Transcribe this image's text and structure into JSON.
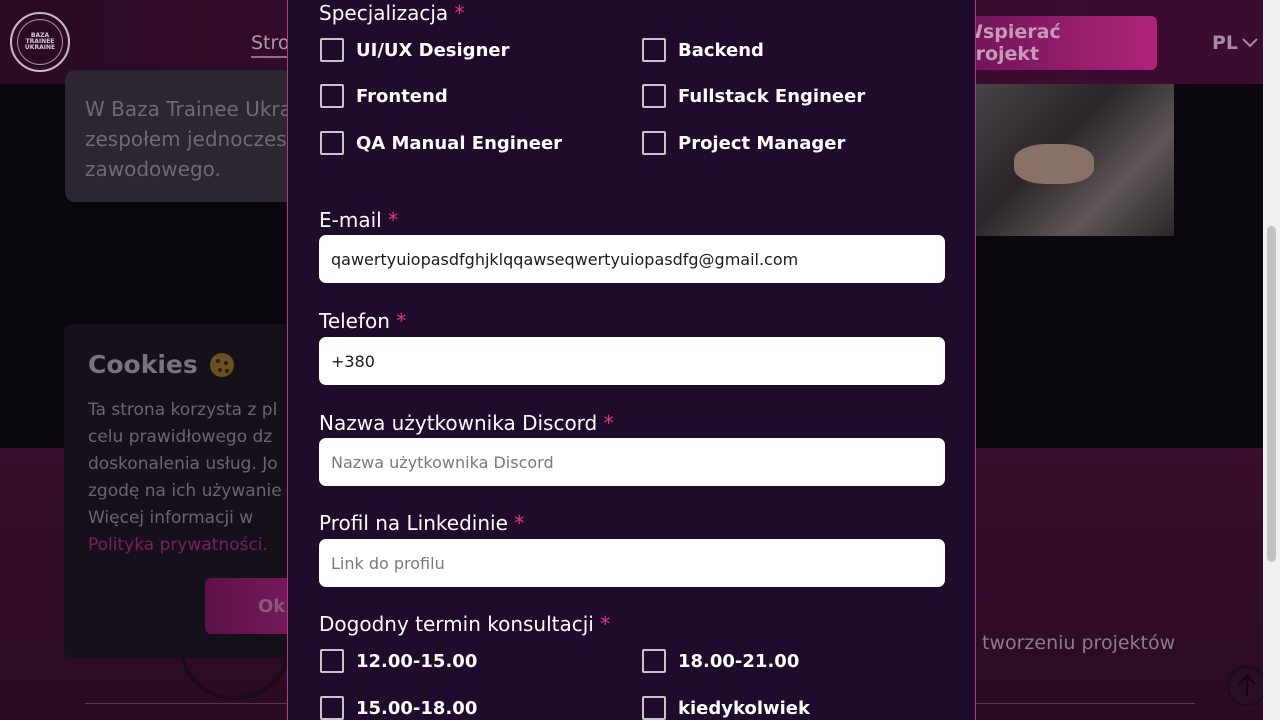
{
  "header": {
    "logo_text": "BAZA\nTRAINEE\nUKRAINE",
    "nav_link": "Stro",
    "support_button": "Wspierać projekt",
    "language": "PL"
  },
  "background": {
    "intro_text": "W Baza Trainee Ukra\nzespołem jednoczes\nzawodowego.",
    "right_text": "tworzeniu projektów"
  },
  "cookies": {
    "title": "Cookies",
    "text": "Ta strona korzysta z pl\ncelu prawidłowego dz\ndoskonalenia usług. Jo\nzgodę na ich używanie\nWięcej informacji w",
    "link": "Polityka prywatności.",
    "ok_button": "Ok"
  },
  "form": {
    "specialization": {
      "label": "Specjalizacja",
      "required": "*",
      "options": [
        "UI/UX Designer",
        "Backend",
        "Frontend",
        "Fullstack Engineer",
        "QA Manual Engineer",
        "Project Manager"
      ]
    },
    "email": {
      "label": "E-mail",
      "required": "*",
      "value": "qawertyuiopasdfghjklqqawseqwertyuiopasdfg@gmail.com"
    },
    "phone": {
      "label": "Telefon",
      "required": "*",
      "value": "+380"
    },
    "discord": {
      "label": "Nazwa użytkownika Discord",
      "required": "*",
      "placeholder": "Nazwa użytkownika Discord"
    },
    "linkedin": {
      "label": "Profil na Linkedinie",
      "required": "*",
      "placeholder": "Link do profilu"
    },
    "consultation": {
      "label": "Dogodny termin konsultacji",
      "required": "*",
      "options": [
        "12.00-15.00",
        "18.00-21.00",
        "15.00-18.00",
        "kiedykolwiek"
      ]
    }
  },
  "colors": {
    "modal_bg": "#1f0b2c",
    "modal_border": "#b33a87",
    "required_asterisk": "#e0367f",
    "input_bg": "#ffffff"
  },
  "icons": {
    "chevron": "chevron-down-icon",
    "scroll_top": "arrow-up-icon",
    "cookie": "cookie-icon"
  }
}
